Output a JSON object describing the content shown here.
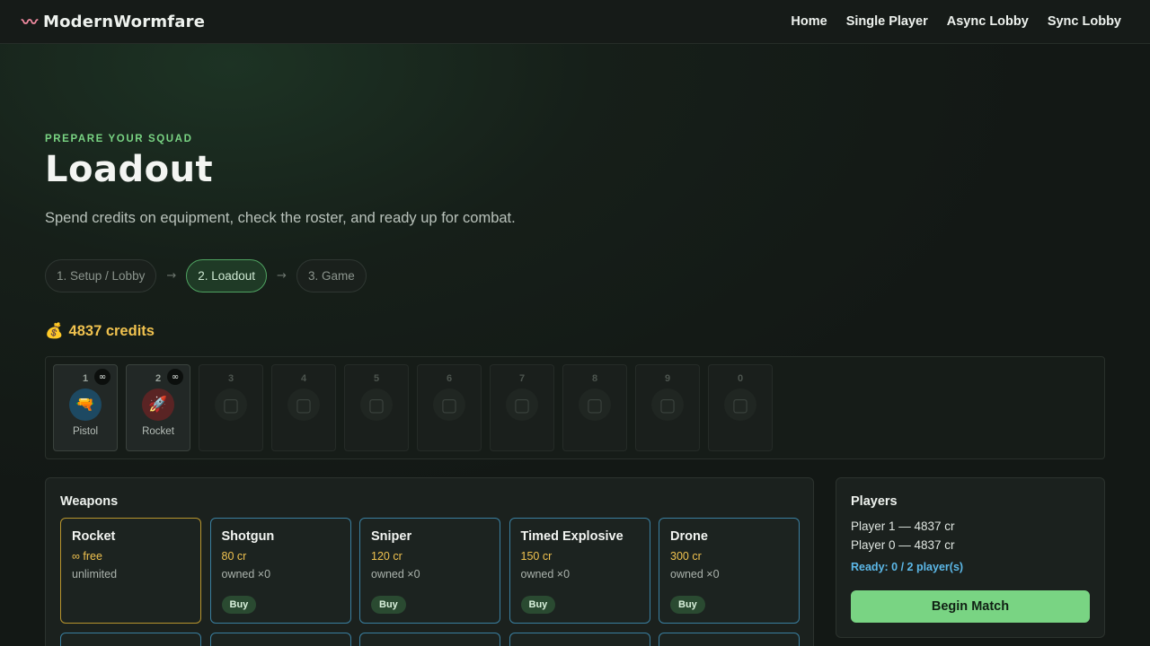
{
  "brand": {
    "name": "ModernWormfare",
    "icon": "worm-icon"
  },
  "nav": [
    "Home",
    "Single Player",
    "Async Lobby",
    "Sync Lobby"
  ],
  "header": {
    "eyebrow": "PREPARE YOUR SQUAD",
    "title": "Loadout",
    "subtitle": "Spend credits on equipment, check the roster, and ready up for combat."
  },
  "steps": [
    {
      "label": "1. Setup / Lobby",
      "active": false
    },
    {
      "label": "2. Loadout",
      "active": true
    },
    {
      "label": "3. Game",
      "active": false
    }
  ],
  "step_arrow": "→",
  "credits": {
    "icon": "money-bag-icon",
    "text": "4837 credits"
  },
  "hotbar": [
    {
      "num": "1",
      "label": "Pistol",
      "badge": "∞",
      "icon": "pistol-icon",
      "glyph": "🔫"
    },
    {
      "num": "2",
      "label": "Rocket",
      "badge": "∞",
      "icon": "rocket-icon",
      "glyph": "🚀"
    },
    {
      "num": "3",
      "glyph": "▢"
    },
    {
      "num": "4",
      "glyph": "▢"
    },
    {
      "num": "5",
      "glyph": "▢"
    },
    {
      "num": "6",
      "glyph": "▢"
    },
    {
      "num": "7",
      "glyph": "▢"
    },
    {
      "num": "8",
      "glyph": "▢"
    },
    {
      "num": "9",
      "glyph": "▢"
    },
    {
      "num": "0",
      "glyph": "▢"
    }
  ],
  "weapons": {
    "title": "Weapons",
    "items": [
      {
        "name": "Rocket",
        "price": "∞ free",
        "owned": "unlimited",
        "selected": true
      },
      {
        "name": "Shotgun",
        "price": "80 cr",
        "owned": "owned ×0",
        "buy": "Buy"
      },
      {
        "name": "Sniper",
        "price": "120 cr",
        "owned": "owned ×0",
        "buy": "Buy"
      },
      {
        "name": "Timed Explosive",
        "price": "150 cr",
        "owned": "owned ×0",
        "buy": "Buy"
      },
      {
        "name": "Drone",
        "price": "300 cr",
        "owned": "owned ×0",
        "buy": "Buy"
      }
    ]
  },
  "players": {
    "title": "Players",
    "list": [
      "Player 1 — 4837 cr",
      "Player 0 — 4837 cr"
    ],
    "ready": "Ready: 0 / 2 player(s)",
    "begin": "Begin Match"
  }
}
